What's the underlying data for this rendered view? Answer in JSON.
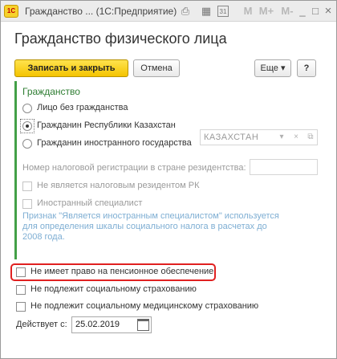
{
  "window": {
    "title": "Гражданство ... (1С:Предприятие)",
    "logo": "1С",
    "toolbar_icons": [
      "printer-icon",
      "calculator-icon",
      "calendar-icon",
      "m-icon",
      "m-plus-icon",
      "m-minus-icon",
      "minimize-icon",
      "maximize-icon",
      "close-icon"
    ],
    "toolbar_glyphs": {
      "m": "M",
      "m_plus": "M+",
      "m_minus": "M-",
      "minimize": "_",
      "maximize": "□",
      "close": "×",
      "calendar": "31"
    }
  },
  "form": {
    "title": "Гражданство физического лица",
    "save_close_label": "Записать и закрыть",
    "cancel_label": "Отмена",
    "more_label": "Еще ▾",
    "help_label": "?"
  },
  "citizenship": {
    "group_title": "Гражданство",
    "options": [
      {
        "label": "Лицо без гражданства",
        "selected": false
      },
      {
        "label": "Гражданин Республики Казахстан",
        "selected": true
      },
      {
        "label": "Гражданин иностранного государства",
        "selected": false
      }
    ],
    "country_value": "КАЗАХСТАН",
    "tax_number_label": "Номер налоговой регистрации в стране резидентства:",
    "tax_number_value": "",
    "not_resident_label": "Не является налоговым резидентом РК",
    "foreign_specialist_label": "Иностранный специалист",
    "note_text": "Признак \"Является иностранным специалистом\" используется для определения шкалы социального налога в расчетах до 2008 года."
  },
  "checkboxes": [
    {
      "label": "Не имеет право на пенсионное обеспечение",
      "checked": false
    },
    {
      "label": "Не подлежит социальному страхованию",
      "checked": false
    },
    {
      "label": "Не подлежит социальному медицинскому страхованию",
      "checked": false
    }
  ],
  "effective": {
    "label": "Действует с:",
    "date": "25.02.2019"
  },
  "colors": {
    "accent_yellow": "#f4c400",
    "group_green": "#43a047",
    "note_blue": "#7eaed3",
    "highlight_red": "#e02020"
  }
}
